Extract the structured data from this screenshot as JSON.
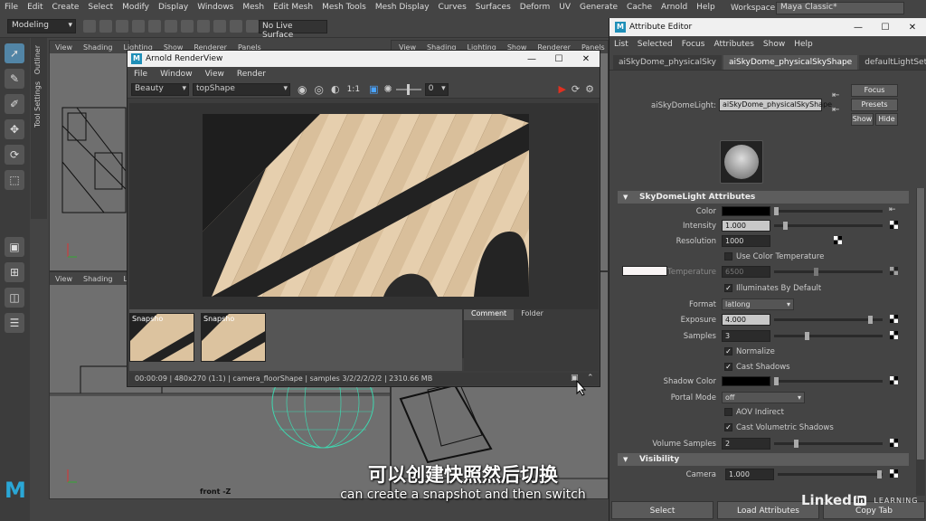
{
  "menubar": [
    "File",
    "Edit",
    "Create",
    "Select",
    "Modify",
    "Display",
    "Windows",
    "Mesh",
    "Edit Mesh",
    "Mesh Tools",
    "Mesh Display",
    "Curves",
    "Surfaces",
    "Deform",
    "UV",
    "Generate",
    "Cache",
    "Arnold",
    "Help"
  ],
  "toolbar": {
    "mode": "Modeling",
    "live_surface": "No Live Surface"
  },
  "workspace": {
    "label": "Workspace :",
    "value": "Maya Classic*"
  },
  "side_tabs": [
    "Outliner",
    "Tool Settings"
  ],
  "viewport_menu": [
    "View",
    "Shading",
    "Lighting",
    "Show",
    "Renderer",
    "Panels"
  ],
  "viewport_menu_short": [
    "View",
    "Shading",
    "Lighting",
    "Show",
    "Renderer",
    "Panels"
  ],
  "viewport_menu_bottom": [
    "View",
    "Shading",
    "Ligh"
  ],
  "viewport_label_front": "front -Z",
  "render_view": {
    "title": "Arnold RenderView",
    "menu": [
      "File",
      "Window",
      "View",
      "Render"
    ],
    "aov": "Beauty",
    "camera": "topShape",
    "ratio": "1:1",
    "exposure": "0",
    "snapshots": [
      "Snapsho",
      "Snapsho"
    ],
    "tabs": [
      "Comment",
      "Folder"
    ],
    "status": "00:00:09  |  480x270 (1:1)  |  camera_floorShape  |  samples 3/2/2/2/2/2  |  2310.66 MB"
  },
  "attr_editor": {
    "title": "Attribute Editor",
    "menu": [
      "List",
      "Selected",
      "Focus",
      "Attributes",
      "Show",
      "Help"
    ],
    "tabs": [
      "aiSkyDome_physicalSky",
      "aiSkyDome_physicalSkyShape",
      "defaultLightSet"
    ],
    "node_label": "aiSkyDomeLight:",
    "node_value": "aiSkyDome_physicalSkyShape",
    "btn_focus": "Focus",
    "btn_presets": "Presets",
    "btn_show": "Show",
    "btn_hide": "Hide",
    "section_skydome": "SkyDomeLight Attributes",
    "color_label": "Color",
    "intensity_label": "Intensity",
    "intensity": "1.000",
    "resolution_label": "Resolution",
    "resolution": "1000",
    "use_color_temp": "Use Color Temperature",
    "temperature_label": "Temperature",
    "temperature": "6500",
    "illuminates": "Illuminates By Default",
    "format_label": "Format",
    "format": "latlong",
    "exposure_label": "Exposure",
    "exposure": "4.000",
    "samples_label": "Samples",
    "samples": "3",
    "normalize": "Normalize",
    "cast_shadows": "Cast Shadows",
    "shadow_color_label": "Shadow Color",
    "portal_mode_label": "Portal Mode",
    "portal_mode": "off",
    "aov_indirect": "AOV Indirect",
    "cast_vol_shadows": "Cast Volumetric Shadows",
    "volume_samples_label": "Volume Samples",
    "volume_samples": "2",
    "section_visibility": "Visibility",
    "camera_label": "Camera",
    "camera": "1.000",
    "bottom_buttons": [
      "Select",
      "Load Attributes",
      "Copy Tab"
    ]
  },
  "subtitle": {
    "cn": "可以创建快照然后切换",
    "en": "can create a snapshot and then switch"
  },
  "brand": {
    "linked": "Linked",
    "in": "in",
    "learning": "LEARNING"
  },
  "colors": {
    "accent": "#5285a6",
    "arnold_logo": "#1f8fb8",
    "maya_logo": "#2aa7d6",
    "render_stop": "#e03020"
  }
}
